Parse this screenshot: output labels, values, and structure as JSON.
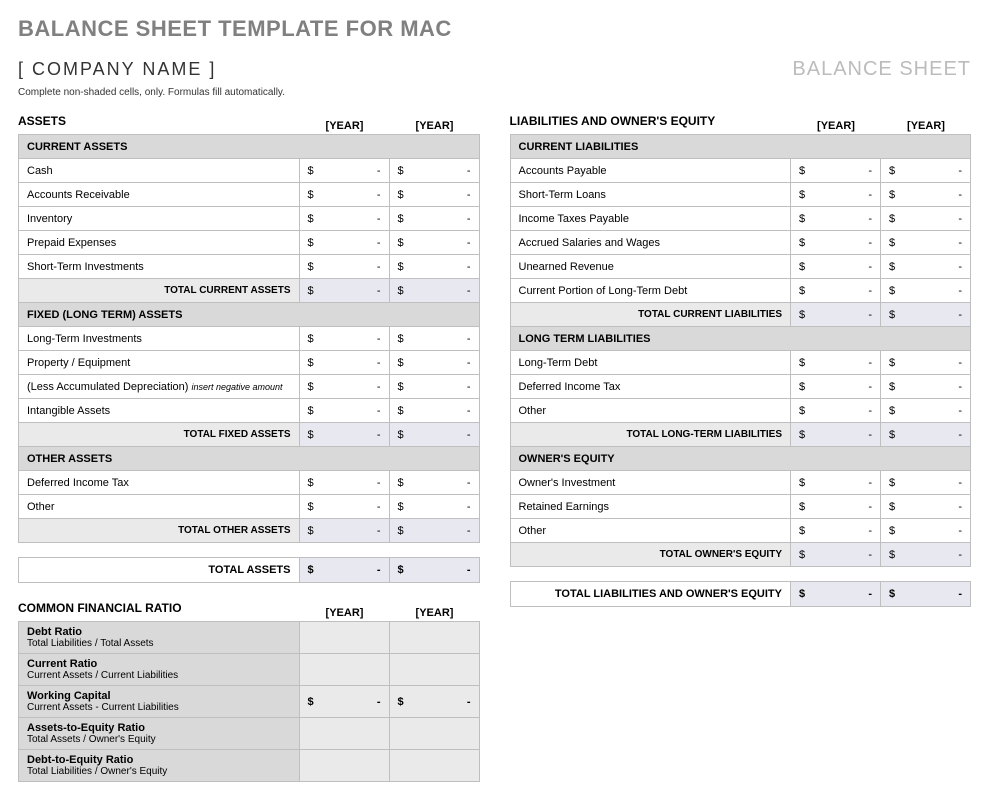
{
  "page_title": "BALANCE SHEET TEMPLATE FOR MAC",
  "company_name": "[ COMPANY NAME ]",
  "balance_sheet_label": "BALANCE SHEET",
  "instructions": "Complete non-shaded cells, only.  Formulas fill automatically.",
  "year1": "[YEAR]",
  "year2": "[YEAR]",
  "currency_symbol": "$",
  "dash": "-",
  "assets": {
    "header": "ASSETS",
    "current": {
      "header": "CURRENT ASSETS",
      "rows": [
        {
          "label": "Cash"
        },
        {
          "label": "Accounts Receivable"
        },
        {
          "label": "Inventory"
        },
        {
          "label": "Prepaid Expenses"
        },
        {
          "label": "Short-Term Investments"
        }
      ],
      "total_label": "TOTAL CURRENT ASSETS"
    },
    "fixed": {
      "header": "FIXED (LONG TERM) ASSETS",
      "rows": [
        {
          "label": "Long-Term Investments"
        },
        {
          "label": "Property / Equipment"
        },
        {
          "label": "(Less Accumulated Depreciation)",
          "note": "insert negative amount"
        },
        {
          "label": "Intangible Assets"
        }
      ],
      "total_label": "TOTAL FIXED ASSETS"
    },
    "other": {
      "header": "OTHER ASSETS",
      "rows": [
        {
          "label": "Deferred Income Tax"
        },
        {
          "label": "Other"
        }
      ],
      "total_label": "TOTAL OTHER ASSETS"
    },
    "grand_total_label": "TOTAL ASSETS"
  },
  "liabilities": {
    "header": "LIABILITIES AND OWNER'S EQUITY",
    "current": {
      "header": "CURRENT LIABILITIES",
      "rows": [
        {
          "label": "Accounts Payable"
        },
        {
          "label": "Short-Term Loans"
        },
        {
          "label": "Income Taxes Payable"
        },
        {
          "label": "Accrued Salaries and Wages"
        },
        {
          "label": "Unearned Revenue"
        },
        {
          "label": "Current Portion of Long-Term Debt"
        }
      ],
      "total_label": "TOTAL CURRENT LIABILITIES"
    },
    "longterm": {
      "header": "LONG TERM LIABILITIES",
      "rows": [
        {
          "label": "Long-Term Debt"
        },
        {
          "label": "Deferred Income Tax"
        },
        {
          "label": "Other"
        }
      ],
      "total_label": "TOTAL LONG-TERM LIABILITIES"
    },
    "equity": {
      "header": "OWNER'S EQUITY",
      "rows": [
        {
          "label": "Owner's Investment"
        },
        {
          "label": "Retained Earnings"
        },
        {
          "label": "Other"
        }
      ],
      "total_label": "TOTAL OWNER'S EQUITY"
    },
    "grand_total_label": "TOTAL LIABILITIES AND OWNER'S EQUITY"
  },
  "ratios": {
    "header": "COMMON FINANCIAL RATIO",
    "items": [
      {
        "name": "Debt Ratio",
        "desc": "Total Liabilities / Total Assets",
        "show_amount": false
      },
      {
        "name": "Current Ratio",
        "desc": "Current Assets / Current Liabilities",
        "show_amount": false
      },
      {
        "name": "Working Capital",
        "desc": "Current Assets - Current Liabilities",
        "show_amount": true
      },
      {
        "name": "Assets-to-Equity Ratio",
        "desc": "Total Assets / Owner's Equity",
        "show_amount": false
      },
      {
        "name": "Debt-to-Equity Ratio",
        "desc": "Total Liabilities / Owner's Equity",
        "show_amount": false
      }
    ]
  }
}
